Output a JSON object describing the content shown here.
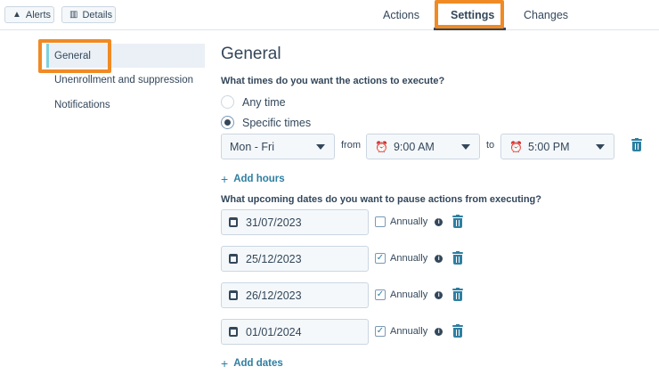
{
  "topbar": {
    "alerts_label": "Alerts",
    "details_label": "Details",
    "tabs": [
      {
        "label": "Actions"
      },
      {
        "label": "Settings"
      },
      {
        "label": "Changes"
      }
    ]
  },
  "sidebar": {
    "items": [
      {
        "label": "General"
      },
      {
        "label": "Unenrollment and suppression"
      },
      {
        "label": "Notifications"
      }
    ]
  },
  "main": {
    "title": "General",
    "question_times": "What times do you want the actions to execute?",
    "radio_any": "Any time",
    "radio_specific": "Specific times",
    "days_value": "Mon - Fri",
    "from_label": "from",
    "from_value": "9:00 AM",
    "to_label": "to",
    "to_value": "5:00 PM",
    "add_hours": "Add hours",
    "question_dates": "What upcoming dates do you want to pause actions from executing?",
    "annually_label": "Annually",
    "dates": [
      {
        "value": "31/07/2023",
        "annually": false
      },
      {
        "value": "25/12/2023",
        "annually": true
      },
      {
        "value": "26/12/2023",
        "annually": true
      },
      {
        "value": "01/01/2024",
        "annually": true
      }
    ],
    "add_dates": "Add dates"
  },
  "colors": {
    "highlight": "#f08a24",
    "link": "#2f7fa1",
    "text": "#33475b",
    "sidebar_active_bg": "#eaf0f6",
    "sidebar_active_bar": "#7fd1de"
  }
}
